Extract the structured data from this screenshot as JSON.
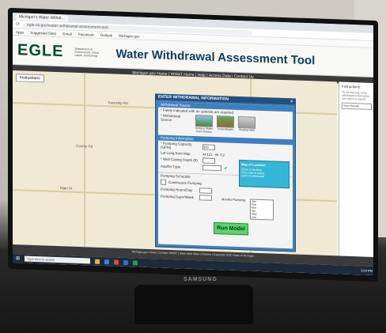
{
  "browser": {
    "tabs": [
      "Michigan's Water Withdr..."
    ],
    "address": "egle.mi.gov/water-withdrawal-assessment-tool",
    "bookmarks": [
      "Apps",
      "Suggested Sites",
      "Gmail",
      "Facebook",
      "Outlook",
      "Michigan.gov"
    ]
  },
  "header": {
    "logo": "EGLE",
    "logo_sub": "Department of Environment, Great Lakes, and Energy",
    "title": "Water Withdrawal Assessment Tool"
  },
  "nav": {
    "links": "Michigan.gov Home | WWAT Home | Help | Access Data | Contact Us"
  },
  "map": {
    "button": "Instructions",
    "labels": [
      "Township Rd",
      "County Rd",
      "Main St"
    ]
  },
  "side": {
    "title": "Instructions",
    "text": "To run the tool, enter withdrawal information and select a source.",
    "button": "View Results"
  },
  "dialog": {
    "title": "ENTER WITHDRAWAL INFORMATION",
    "close": "x",
    "section1": "Withdrawal Source",
    "required_note": "* Fields indicated with an asterisk are required",
    "source_label": "* Withdrawal Source",
    "choices": [
      "Surface Water from Stream",
      "Groundwater",
      "Shallow Well"
    ],
    "section2": "Pumping Information",
    "pump_capacity_label": "* Pumping Capacity (GPM)",
    "pump_capacity_value": "300",
    "latlon_label": "Lat Long from Map",
    "latlon_value": "44.123, -85.712",
    "well_depth_label": "* Well Casing Depth (ft)",
    "aquifer_label": "Aquifer Type",
    "info_title": "Map of Location",
    "info_lines": [
      "Zoom to location",
      "Click map to select",
      "point of withdrawal"
    ],
    "section3": "Pumping Schedule",
    "continuous_label": "Continuous Pumping",
    "hours_label": "Pumping Hours/Day",
    "days_label": "Pumping Days/Week",
    "months_label": "Months Pumping",
    "months": [
      "Jan",
      "Feb",
      "Mar",
      "Apr",
      "May",
      "Jun"
    ],
    "run_button": "Run Model"
  },
  "footer": {
    "text": "Michigan.gov Home | Contact WWAT | State Web Sites | Policies | Copyright 2020 State of Michigan"
  },
  "taskbar": {
    "search": "Type here to search",
    "time": "3:04 PM"
  },
  "monitor": {
    "brand": "SAMSUNG"
  }
}
